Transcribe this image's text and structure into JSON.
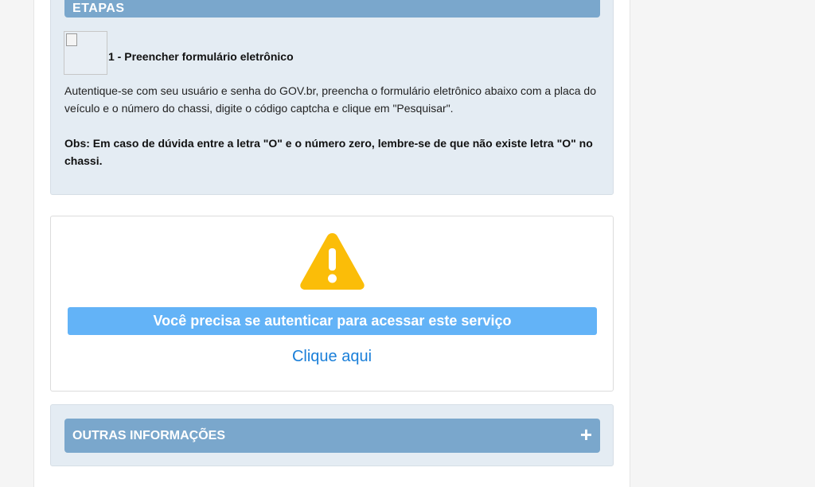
{
  "etapas": {
    "header": "ETAPAS",
    "step_title": "1 - Preencher formulário eletrônico",
    "description": "Autentique-se com seu usuário e senha do GOV.br, preencha o formulário eletrônico abaixo com a placa do veículo e o número do chassi, digite o código captcha e clique em \"Pesquisar\".",
    "obs": "Obs: Em caso de dúvida entre a letra \"O\" e o número zero, lembre-se de que não existe letra \"O\" no chassi."
  },
  "auth": {
    "icon": "warning-triangle-icon",
    "message": "Você precisa se autenticar para acessar este serviço",
    "link": "Clique aqui"
  },
  "outras": {
    "header": "OUTRAS INFORMAÇÕES",
    "toggle_icon": "plus-icon"
  },
  "colors": {
    "panel_header": "#7aa7cc",
    "panel_bg": "#e4ecf3",
    "banner": "#63b3f7",
    "link": "#1a7fd9",
    "warning": "#fbbd08"
  }
}
